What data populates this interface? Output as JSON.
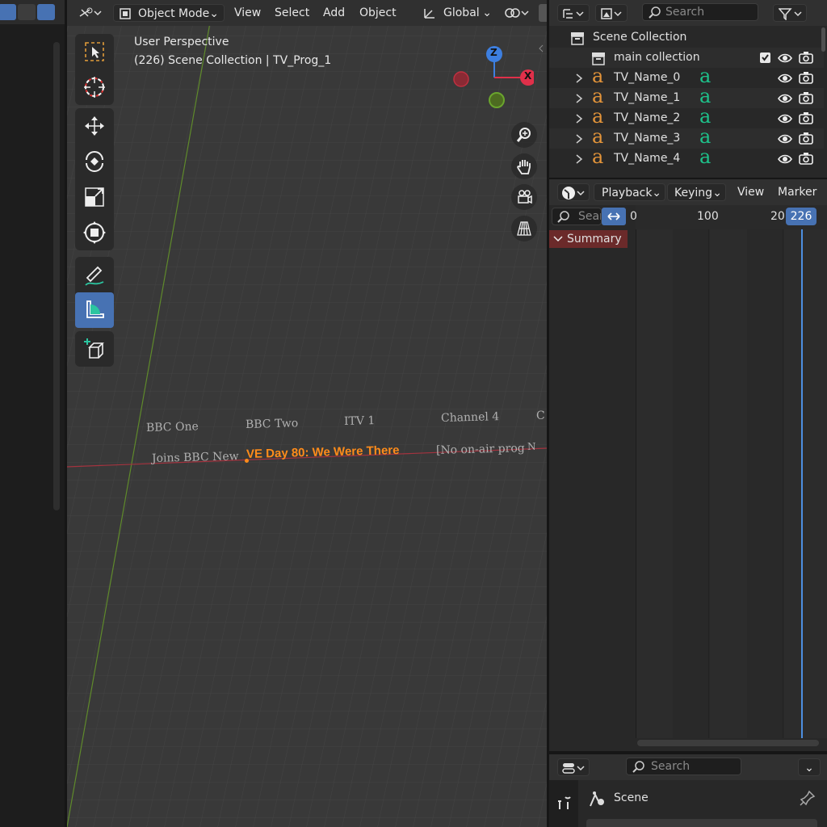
{
  "viewport": {
    "header": {
      "mode": "Object Mode",
      "menus": [
        "View",
        "Select",
        "Add",
        "Object"
      ],
      "orientation": "Global"
    },
    "overlay": {
      "perspective": "User Perspective",
      "context": "(226) Scene Collection | TV_Prog_1"
    },
    "gizmo": {
      "z": "Z",
      "x": "X"
    },
    "scene_text": {
      "channels": [
        "BBC One",
        "BBC Two",
        "ITV 1",
        "Channel 4",
        "C"
      ],
      "programme_row_prefix": "Joins BBC New",
      "highlight": "VE Day 80: We Were There",
      "programme_row_suffix": "[No on-air prog",
      "overlap_fragment": "N"
    }
  },
  "outliner": {
    "search_placeholder": "Search",
    "root": "Scene Collection",
    "collection": "main collection",
    "items": [
      {
        "name": "TV_Name_0"
      },
      {
        "name": "TV_Name_1"
      },
      {
        "name": "TV_Name_2"
      },
      {
        "name": "TV_Name_3"
      },
      {
        "name": "TV_Name_4"
      }
    ],
    "text_glyph": "a"
  },
  "timeline": {
    "menus": [
      "Playback",
      "Keying",
      "View",
      "Marker"
    ],
    "search_placeholder": "Sear",
    "ruler": [
      "0",
      "100",
      "20"
    ],
    "current_frame": "226",
    "summary": "Summary"
  },
  "properties": {
    "search_placeholder": "Search",
    "scene_label": "Scene"
  },
  "colors": {
    "accent": "#4772b3",
    "orange": "#ff8c1a",
    "text_green": "#1ec28b",
    "axis_red": "#c03040",
    "axis_green": "#6aa52d"
  }
}
